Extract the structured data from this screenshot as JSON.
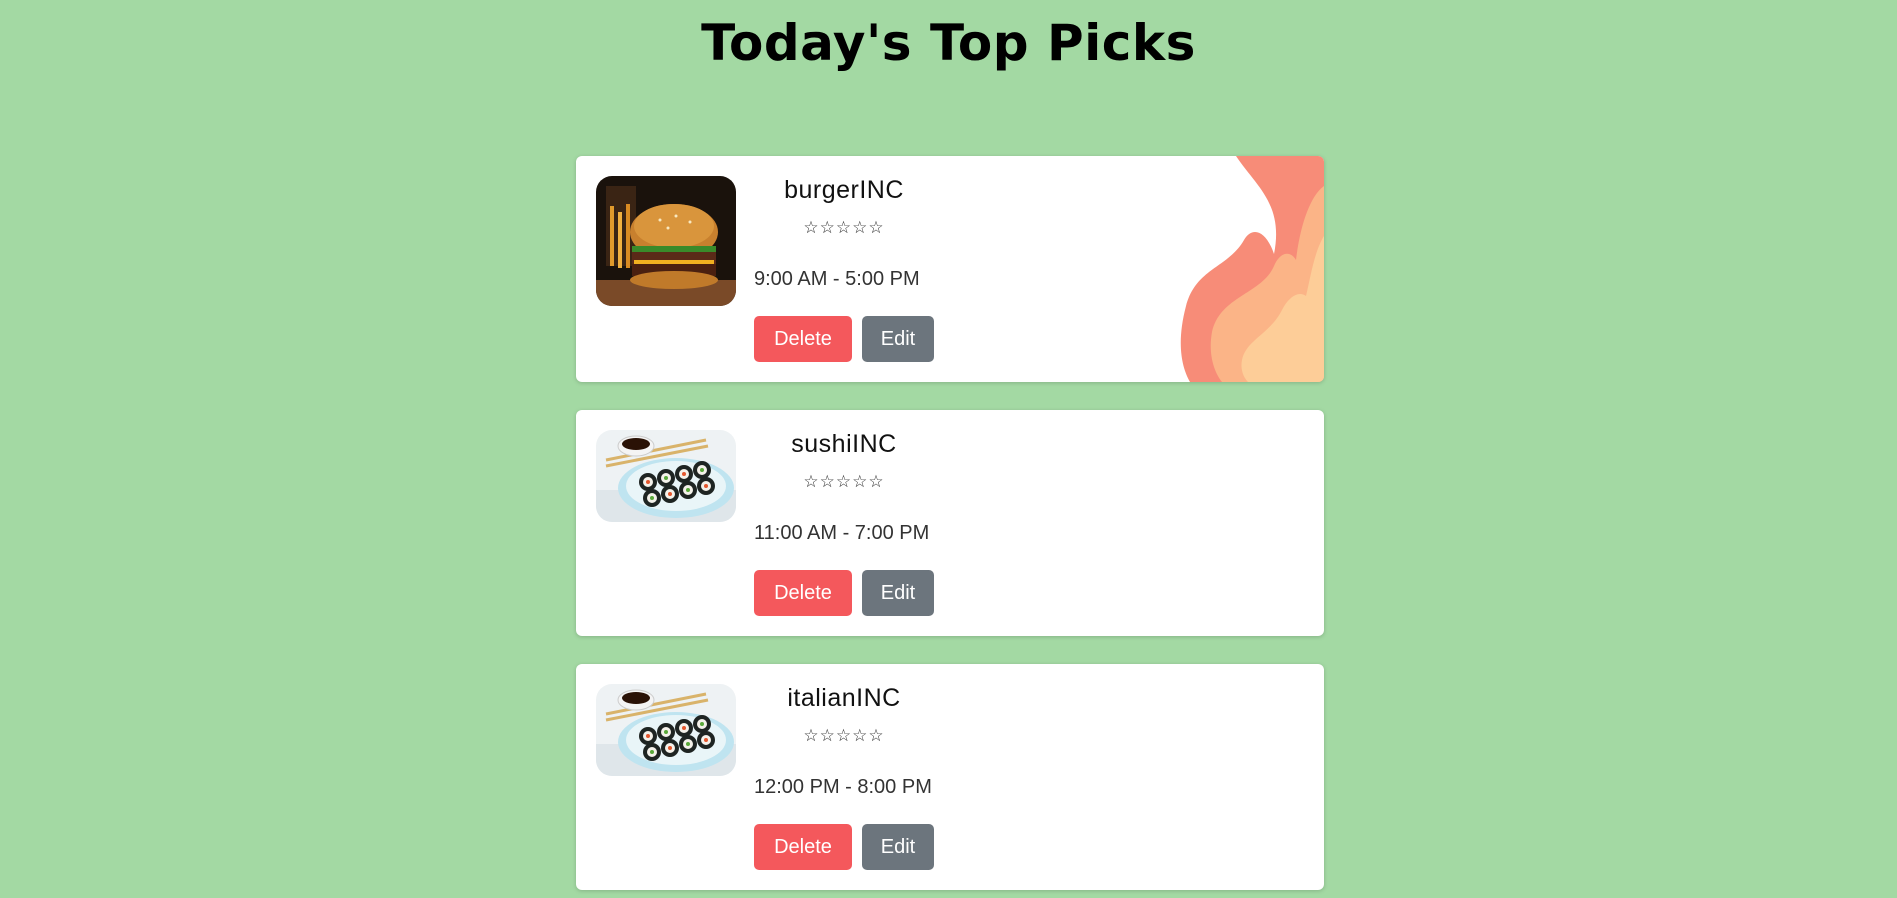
{
  "page": {
    "title": "Today's Top Picks"
  },
  "colors": {
    "background": "#a3d9a3",
    "delete_button": "#f4585c",
    "edit_button": "#6c757d",
    "card": "#ffffff"
  },
  "restaurants": [
    {
      "name": "burgerINC",
      "rating_display": "☆☆☆☆☆",
      "rating": 0,
      "hours": "9:00 AM - 5:00 PM",
      "image": "burger-photo",
      "featured": true,
      "delete_label": "Delete",
      "edit_label": "Edit"
    },
    {
      "name": "sushiINC",
      "rating_display": "☆☆☆☆☆",
      "rating": 0,
      "hours": "11:00 AM - 7:00 PM",
      "image": "sushi-photo",
      "featured": false,
      "delete_label": "Delete",
      "edit_label": "Edit"
    },
    {
      "name": "italianINC",
      "rating_display": "☆☆☆☆☆",
      "rating": 0,
      "hours": "12:00 PM - 8:00 PM",
      "image": "sushi-photo",
      "featured": false,
      "delete_label": "Delete",
      "edit_label": "Edit"
    }
  ]
}
